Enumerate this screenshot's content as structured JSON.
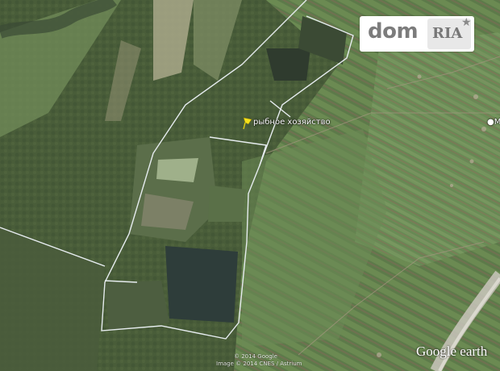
{
  "logo": {
    "dom_text": "dom",
    "ria_text": "RIA",
    "star_icon": "star-icon"
  },
  "map": {
    "placemark_label": "рыбное хозяйство",
    "place_label_right": "Ме",
    "copyright_line1": "© 2014 Google",
    "copyright_line2": "Image © 2014 CNES / Astrium",
    "provider_text": "Google earth",
    "boundary_color": "#e6ecef",
    "pin_color": "#f5e11a"
  }
}
